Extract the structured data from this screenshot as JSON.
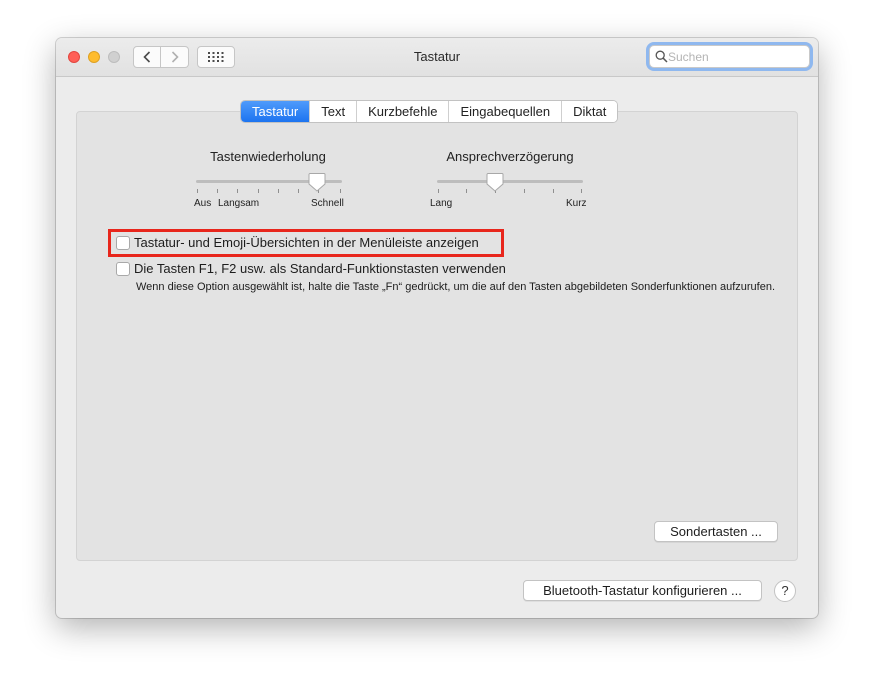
{
  "window": {
    "title": "Tastatur",
    "search_placeholder": "Suchen"
  },
  "tabs": [
    {
      "label": "Tastatur",
      "active": true
    },
    {
      "label": "Text",
      "active": false
    },
    {
      "label": "Kurzbefehle",
      "active": false
    },
    {
      "label": "Eingabequellen",
      "active": false
    },
    {
      "label": "Diktat",
      "active": false
    }
  ],
  "sliders": {
    "repeat": {
      "label": "Tastenwiederholung",
      "min_label": "Aus",
      "mid_label": "Langsam",
      "max_label": "Schnell",
      "value_fraction": 0.83
    },
    "delay": {
      "label": "Ansprechverzögerung",
      "min_label": "Lang",
      "max_label": "Kurz",
      "value_fraction": 0.4
    }
  },
  "options": {
    "emoji_viewer": {
      "label": "Tastatur- und Emoji-Übersichten in der Menüleiste anzeigen",
      "checked": false,
      "highlighted": true
    },
    "fn_keys": {
      "label": "Die Tasten F1, F2 usw. als Standard-Funktionstasten verwenden",
      "checked": false,
      "description": "Wenn diese Option ausgewählt ist, halte die Taste „Fn“ gedrückt, um die auf den Tasten abgebildeten Sonderfunktionen aufzurufen."
    }
  },
  "buttons": {
    "modifier_keys": "Sondertasten ...",
    "bluetooth": "Bluetooth-Tastatur konfigurieren ...",
    "help": "?"
  },
  "colors": {
    "accent": "#1d74f0",
    "highlight_border": "#e8261c"
  }
}
